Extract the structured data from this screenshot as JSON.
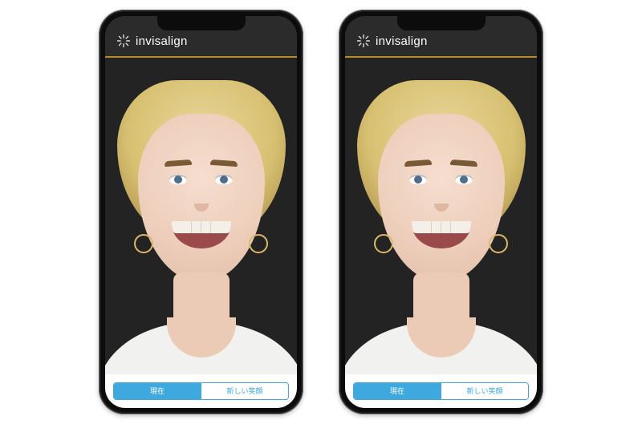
{
  "brand": {
    "name": "invisalign",
    "accent_color": "#b88a2c",
    "primary_color": "#3fa9df"
  },
  "phones": [
    {
      "segmented": {
        "selected": 0,
        "options": [
          "現在",
          "新しい笑顔"
        ]
      }
    },
    {
      "segmented": {
        "selected": 0,
        "options": [
          "現在",
          "新しい笑顔"
        ]
      }
    }
  ]
}
